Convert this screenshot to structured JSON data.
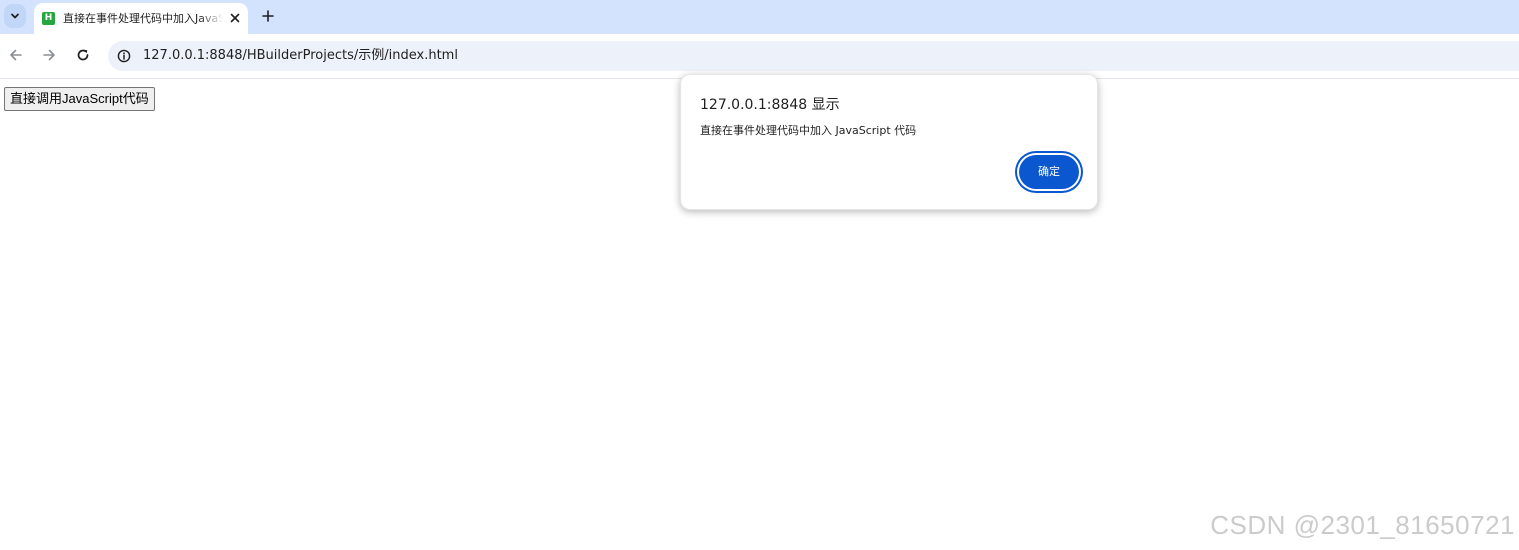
{
  "tabstrip": {
    "tab": {
      "favicon_letter": "H",
      "title": "直接在事件处理代码中加入JavaScript代码"
    },
    "icons": {
      "tab_search": "chevron-down-icon",
      "close": "close-icon",
      "new_tab": "plus-icon"
    }
  },
  "toolbar": {
    "icons": {
      "back": "back-arrow-icon",
      "forward": "forward-arrow-icon",
      "reload": "reload-icon",
      "site_info": "info-icon"
    },
    "url": "127.0.0.1:8848/HBuilderProjects/示例/index.html"
  },
  "page": {
    "button_label": "直接调用JavaScript代码"
  },
  "dialog": {
    "title": "127.0.0.1:8848 显示",
    "message": "直接在事件处理代码中加入 JavaScript 代码",
    "ok_label": "确定"
  },
  "watermark": "CSDN @2301_81650721",
  "colors": {
    "tabstrip_bg": "#d3e3fd",
    "omnibox_bg": "#edf2fa",
    "accent": "#0b57d0",
    "favicon": "#26a641"
  }
}
